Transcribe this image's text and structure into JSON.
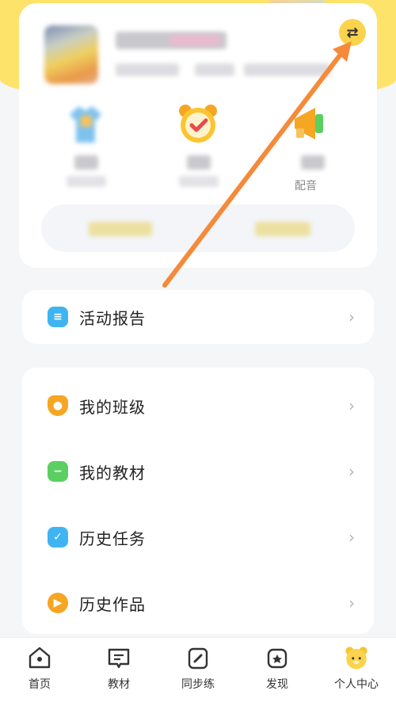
{
  "header": {
    "switch_icon": "switch-arrows-icon",
    "stats": [
      {
        "icon": "shirt-icon",
        "partial_label": ""
      },
      {
        "icon": "alarm-clock-icon",
        "partial_label": ""
      },
      {
        "icon": "megaphone-icon",
        "partial_label": "配音"
      }
    ]
  },
  "menu_top": [
    {
      "label": "活动报告",
      "icon": "report-icon",
      "color": "#3fb4f2"
    }
  ],
  "menu_main": [
    {
      "label": "我的班级",
      "icon": "class-shield-icon",
      "color": "#f6a623"
    },
    {
      "label": "我的教材",
      "icon": "textbook-icon",
      "color": "#5ccf63"
    },
    {
      "label": "历史任务",
      "icon": "task-icon",
      "color": "#3fb4f2"
    },
    {
      "label": "历史作品",
      "icon": "works-play-icon",
      "color": "#f6a623"
    }
  ],
  "tabbar": {
    "tabs": [
      {
        "label": "首页",
        "icon": "home-icon"
      },
      {
        "label": "教材",
        "icon": "book-icon"
      },
      {
        "label": "同步练",
        "icon": "pencil-icon"
      },
      {
        "label": "发现",
        "icon": "discover-icon"
      },
      {
        "label": "个人中心",
        "icon": "bear-icon"
      }
    ]
  },
  "colors": {
    "accent_yellow": "#fde36a",
    "arrow_orange": "#f58a3a"
  }
}
